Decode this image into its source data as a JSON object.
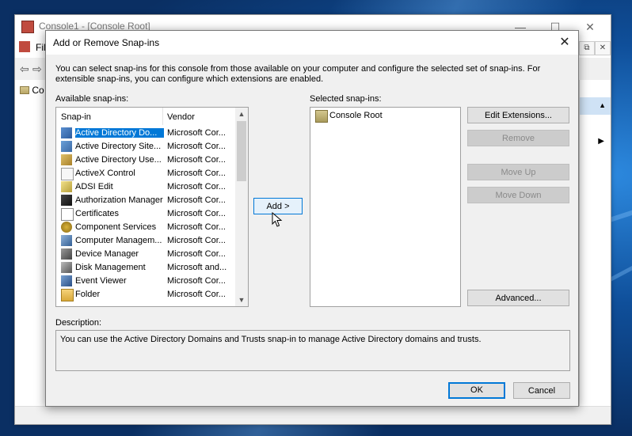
{
  "console": {
    "title": "Console1 - [Console Root]",
    "menu_file": "Fil",
    "tree_root": "Co",
    "window_controls": [
      "—",
      "☐",
      "✕"
    ],
    "inner_controls": [
      "⧉",
      "✕"
    ]
  },
  "dialog": {
    "title": "Add or Remove Snap-ins",
    "close_glyph": "✕",
    "intro": "You can select snap-ins for this console from those available on your computer and configure the selected set of snap-ins. For extensible snap-ins, you can configure which extensions are enabled.",
    "available_label": "Available snap-ins:",
    "selected_label": "Selected snap-ins:",
    "columns": {
      "snapin": "Snap-in",
      "vendor": "Vendor"
    },
    "available": [
      {
        "name": "Active Directory Do...",
        "vendor": "Microsoft Cor...",
        "icon": "ad-domains-icon",
        "selected": true
      },
      {
        "name": "Active Directory Site...",
        "vendor": "Microsoft Cor...",
        "icon": "ad-sites-icon"
      },
      {
        "name": "Active Directory Use...",
        "vendor": "Microsoft Cor...",
        "icon": "ad-users-icon"
      },
      {
        "name": "ActiveX Control",
        "vendor": "Microsoft Cor...",
        "icon": "activex-icon"
      },
      {
        "name": "ADSI Edit",
        "vendor": "Microsoft Cor...",
        "icon": "adsi-edit-icon"
      },
      {
        "name": "Authorization Manager",
        "vendor": "Microsoft Cor...",
        "icon": "authorization-icon"
      },
      {
        "name": "Certificates",
        "vendor": "Microsoft Cor...",
        "icon": "certificates-icon"
      },
      {
        "name": "Component Services",
        "vendor": "Microsoft Cor...",
        "icon": "component-services-icon"
      },
      {
        "name": "Computer Managem...",
        "vendor": "Microsoft Cor...",
        "icon": "computer-management-icon"
      },
      {
        "name": "Device Manager",
        "vendor": "Microsoft Cor...",
        "icon": "device-manager-icon"
      },
      {
        "name": "Disk Management",
        "vendor": "Microsoft and...",
        "icon": "disk-management-icon"
      },
      {
        "name": "Event Viewer",
        "vendor": "Microsoft Cor...",
        "icon": "event-viewer-icon"
      },
      {
        "name": "Folder",
        "vendor": "Microsoft Cor...",
        "icon": "folder-icon"
      }
    ],
    "selected_items": [
      {
        "name": "Console Root",
        "icon": "folder-icon"
      }
    ],
    "buttons": {
      "add": "Add >",
      "edit_extensions": "Edit Extensions...",
      "remove": "Remove",
      "move_up": "Move Up",
      "move_down": "Move Down",
      "advanced": "Advanced...",
      "ok": "OK",
      "cancel": "Cancel"
    },
    "description_label": "Description:",
    "description": "You can use the Active Directory Domains and Trusts snap-in to manage Active Directory domains and trusts."
  },
  "colors": {
    "accent": "#0078d7",
    "dialog_bg": "#f0f0f0"
  }
}
